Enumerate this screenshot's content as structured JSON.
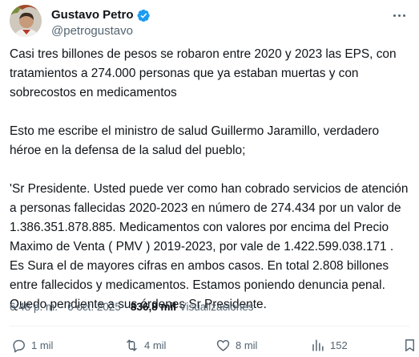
{
  "user": {
    "name": "Gustavo Petro",
    "handle": "@petrogustavo"
  },
  "tweet": {
    "paragraphs": [
      "Casi tres billones de pesos se robaron entre 2020 y 2023 las EPS, con tratamientos a 274.000 personas que ya estaban muertas y con sobrecostos en medicamentos",
      "Esto me escribe el ministro de salud Guillermo Jaramillo, verdadero héroe en la defensa de la salud del pueblo;",
      "'Sr Presidente. Usted puede ver como han cobrado servicios de atención a personas fallecidas 2020-2023 en número de 274.434 por un valor de 1.386.351.878.885. Medicamentos con valores por encima del Precio Maximo de Venta ( PMV ) 2019-2023, por vale de 1.422.599.038.171 . Es Sura el de mayores cifras en ambos casos. En total 2.808 billones entre fallecidos y medicamentos. Estamos poniendo denuncia penal. Quedo pendiente a sus órdenes Sr Presidente."
    ]
  },
  "meta": {
    "time": "6:48 p. m.",
    "separator": "·",
    "date": "6 oct. 2025",
    "views_count": "836,8 mil",
    "views_label": "Visualizaciones"
  },
  "actions": {
    "replies": "1 mil",
    "reposts": "4 mil",
    "likes": "8 mil",
    "views": "152"
  },
  "colors": {
    "verified": "#1d9bf0",
    "secondary_text": "#536471",
    "primary_text": "#0f1419",
    "divider": "#eff3f4"
  },
  "icons": {
    "verified": "verified-badge-icon",
    "more": "more-options-icon",
    "reply": "reply-icon",
    "repost": "repost-icon",
    "like": "heart-icon",
    "views": "views-chart-icon",
    "bookmark": "bookmark-icon"
  }
}
